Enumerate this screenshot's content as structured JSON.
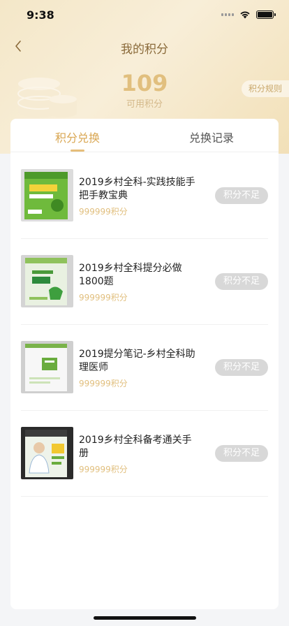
{
  "status_bar": {
    "time": "9:38"
  },
  "nav": {
    "title": "我的积分",
    "back_icon": "chevron-left-icon"
  },
  "points": {
    "value": "109",
    "caption": "可用积分",
    "rules_label": "积分规则"
  },
  "tabs": [
    {
      "label": "积分兑换",
      "active": true
    },
    {
      "label": "兑换记录",
      "active": false
    }
  ],
  "items": [
    {
      "title": "2019乡村全科-实践技能手把手教宝典",
      "points": "999999积分",
      "button": "积分不足"
    },
    {
      "title": "2019乡村全科提分必做1800题",
      "points": "999999积分",
      "button": "积分不足"
    },
    {
      "title": "2019提分笔记-乡村全科助理医师",
      "points": "999999积分",
      "button": "积分不足"
    },
    {
      "title": "2019乡村全科备考通关手册",
      "points": "999999积分",
      "button": "积分不足"
    }
  ],
  "colors": {
    "accent": "#e1bf7e",
    "nav_title": "#8a6a3a",
    "button_disabled": "#d8d8d8"
  }
}
